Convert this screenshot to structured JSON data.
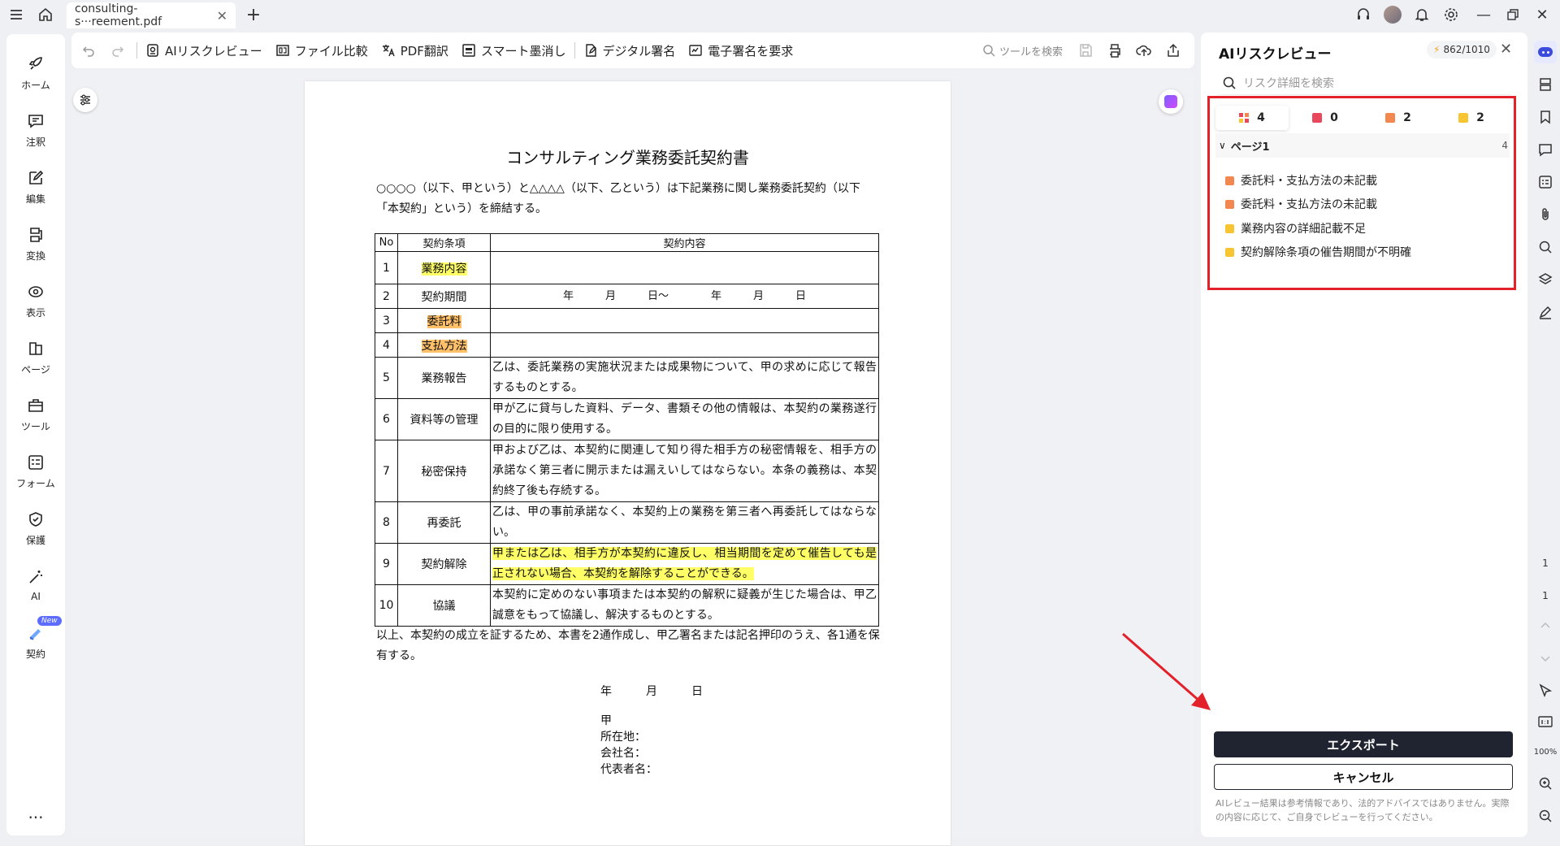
{
  "titlebar": {
    "tab_label": "consulting-s···reement.pdf"
  },
  "leftnav": {
    "items": [
      {
        "label": "ホーム",
        "icon": "home-rocket-icon"
      },
      {
        "label": "注釈",
        "icon": "comment-icon"
      },
      {
        "label": "編集",
        "icon": "edit-icon"
      },
      {
        "label": "変換",
        "icon": "convert-icon"
      },
      {
        "label": "表示",
        "icon": "view-icon"
      },
      {
        "label": "ページ",
        "icon": "pages-icon"
      },
      {
        "label": "ツール",
        "icon": "toolbox-icon"
      },
      {
        "label": "フォーム",
        "icon": "form-icon"
      },
      {
        "label": "保護",
        "icon": "shield-icon"
      },
      {
        "label": "AI",
        "icon": "ai-wand-icon"
      },
      {
        "label": "契約",
        "icon": "contract-icon"
      }
    ],
    "new_badge": "New",
    "more": "···"
  },
  "toolbar": {
    "ai_review": "AIリスクレビュー",
    "compare": "ファイル比較",
    "translate": "PDF翻訳",
    "redact": "スマート墨消し",
    "digital_sign": "デジタル署名",
    "request_sign": "電子署名を要求",
    "search_placeholder": "ツールを検索"
  },
  "document": {
    "title": "コンサルティング業務委託契約書",
    "intro": "○○○○（以下、甲という）と△△△△（以下、乙という）は下記業務に関し業務委託契約（以下「本契約」という）を締結する。",
    "headers": {
      "no": "No",
      "term": "契約条項",
      "content": "契約内容"
    },
    "period_text": "年　　　月　　　日〜　　　　年　　　月　　　日",
    "rows": [
      {
        "no": "1",
        "term": "業務内容",
        "content": ""
      },
      {
        "no": "2",
        "term": "契約期間",
        "content": ""
      },
      {
        "no": "3",
        "term": "委託料",
        "content": ""
      },
      {
        "no": "4",
        "term": "支払方法",
        "content": ""
      },
      {
        "no": "5",
        "term": "業務報告",
        "content": "乙は、委託業務の実施状況または成果物について、甲の求めに応じて報告するものとする。"
      },
      {
        "no": "6",
        "term": "資料等の管理",
        "content": "甲が乙に貸与した資料、データ、書類その他の情報は、本契約の業務遂行の目的に限り使用する。"
      },
      {
        "no": "7",
        "term": "秘密保持",
        "content": "甲および乙は、本契約に関連して知り得た相手方の秘密情報を、相手方の承諾なく第三者に開示または漏えいしてはならない。本条の義務は、本契約終了後も存続する。"
      },
      {
        "no": "8",
        "term": "再委託",
        "content": "乙は、甲の事前承諾なく、本契約上の業務を第三者へ再委託してはならない。"
      },
      {
        "no": "9",
        "term": "契約解除",
        "content": "甲または乙は、相手方が本契約に違反し、相当期間を定めて催告しても是正されない場合、本契約を解除することができる。"
      },
      {
        "no": "10",
        "term": "協議",
        "content": "本契約に定めのない事項または本契約の解釈に疑義が生じた場合は、甲乙誠意をもって協議し、解決するものとする。"
      }
    ],
    "footer": "以上、本契約の成立を証するため、本書を2通作成し、甲乙署名または記名押印のうえ、各1通を保有する。",
    "date_line": "年　　　月　　　日",
    "party": "甲",
    "address": "所在地：",
    "company": "会社名：",
    "rep": "代表者名："
  },
  "panel": {
    "title": "AIリスクレビュー",
    "credit": "862/1010",
    "search_placeholder": "リスク詳細を検索",
    "filters": [
      {
        "count": "4",
        "color": "#e8584f"
      },
      {
        "count": "0",
        "color": "#e8485a"
      },
      {
        "count": "2",
        "color": "#f2874f"
      },
      {
        "count": "2",
        "color": "#f7c531"
      }
    ],
    "group_label": "ページ1",
    "group_count": "4",
    "risks": [
      {
        "label": "委託料・支払方法の未記載",
        "color": "#f2874f"
      },
      {
        "label": "委託料・支払方法の未記載",
        "color": "#f2874f"
      },
      {
        "label": "業務内容の詳細記載不足",
        "color": "#f7c531"
      },
      {
        "label": "契約解除条項の催告期間が不明確",
        "color": "#f7c531"
      }
    ],
    "export": "エクスポート",
    "cancel": "キャンセル",
    "disclaimer": "AIレビュー結果は参考情報であり、法的アドバイスではありません。実際の内容に応じて、ご自身でレビューを行ってください。"
  },
  "rightbar": {
    "page_current": "1",
    "page_total": "1",
    "zoom": "100%"
  },
  "colors": {
    "highlight_yellow": "#ffff66",
    "highlight_orange": "#ffc06a",
    "annotation_red": "#e3212b",
    "export_button": "#1f2430"
  }
}
